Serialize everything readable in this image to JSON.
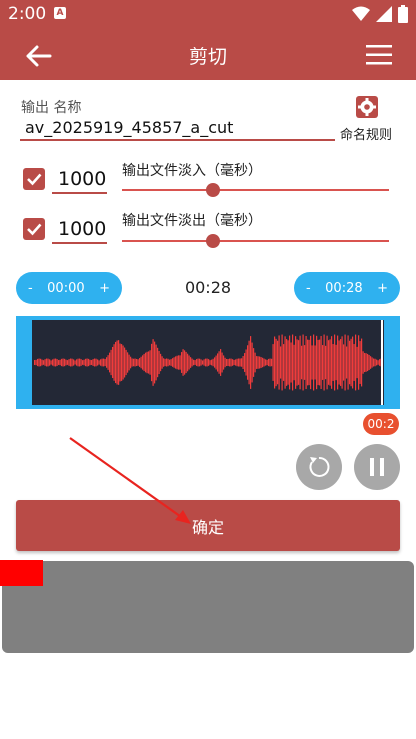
{
  "status_bar": {
    "time": "2:00",
    "badge": "A"
  },
  "app_bar": {
    "title": "剪切"
  },
  "name_field": {
    "label": "输出 名称",
    "value": "av_2025919_45857_a_cut",
    "rule_label": "命名规则"
  },
  "fade_in": {
    "checked": true,
    "value": "1000",
    "label": "输出文件淡入（毫秒）",
    "level": 0.34
  },
  "fade_out": {
    "checked": true,
    "value": "1000",
    "label": "输出文件淡出（毫秒）",
    "level": 0.34
  },
  "start_time": {
    "minus": "-",
    "value": "00:00",
    "plus": "+"
  },
  "end_time": {
    "minus": "-",
    "value": "00:28",
    "plus": "+"
  },
  "duration": "00:28",
  "position_badge": "00:2",
  "confirm_button": "确定",
  "colors": {
    "primary": "#b94b47",
    "accent_blue": "#2fb1ef",
    "wave": "#f03c3c",
    "wave_bg": "#232836"
  }
}
